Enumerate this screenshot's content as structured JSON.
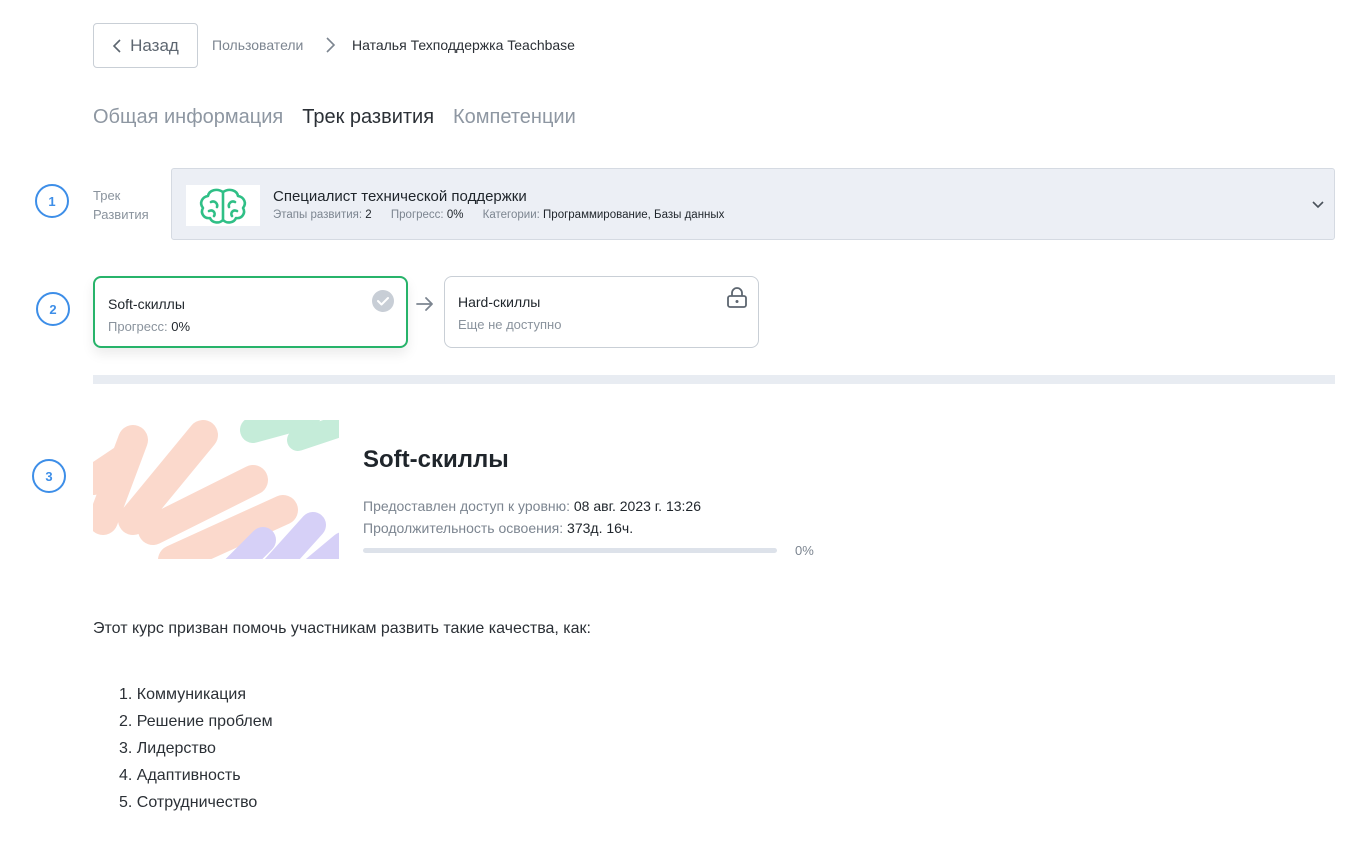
{
  "header": {
    "back_label": "Назад",
    "breadcrumb": {
      "parent": "Пользователи",
      "current": "Наталья Техподдержка Teachbase"
    }
  },
  "tabs": [
    {
      "label": "Общая информация",
      "active": false
    },
    {
      "label": "Трек развития",
      "active": true
    },
    {
      "label": "Компетенции",
      "active": false
    }
  ],
  "step_markers": [
    "1",
    "2",
    "3"
  ],
  "track": {
    "label_line1": "Трек",
    "label_line2": "Развития",
    "title": "Специалист технической поддержки",
    "thumbnail_icon": "brain-icon",
    "stages_label": "Этапы развития:",
    "stages_value": "2",
    "progress_label": "Прогресс:",
    "progress_value": "0%",
    "categories_label": "Категории:",
    "categories_value": "Программирование, Базы данных"
  },
  "stages": [
    {
      "title": "Soft-скиллы",
      "sub_label": "Прогресс:",
      "sub_value": "0%",
      "status_icon": "check-circle-icon",
      "selected": true
    },
    {
      "title": "Hard-скиллы",
      "sub_label": "Еще не доступно",
      "status_icon": "lock-icon",
      "selected": false
    }
  ],
  "level": {
    "title": "Soft-скиллы",
    "access_label": "Предоставлен доступ к уровню:",
    "access_value": "08 авг. 2023 г. 13:26",
    "duration_label": "Продолжительность освоения:",
    "duration_value": "373д. 16ч.",
    "progress_fraction": 0,
    "progress_text": "0%"
  },
  "description": {
    "intro": "Этот курс призван помочь участникам развить такие качества, как:",
    "items": [
      "1. Коммуникация",
      "2. Решение проблем",
      "3. Лидерство",
      "4. Адаптивность",
      "5. Сотрудничество"
    ]
  },
  "colors": {
    "accent_green": "#27b36a",
    "marker_blue": "#3d8ee8",
    "brain_green": "#2fbf86",
    "art_peach": "#fbd9cc",
    "art_mint": "#c5ecd9",
    "art_lavender": "#d6d0f7"
  }
}
